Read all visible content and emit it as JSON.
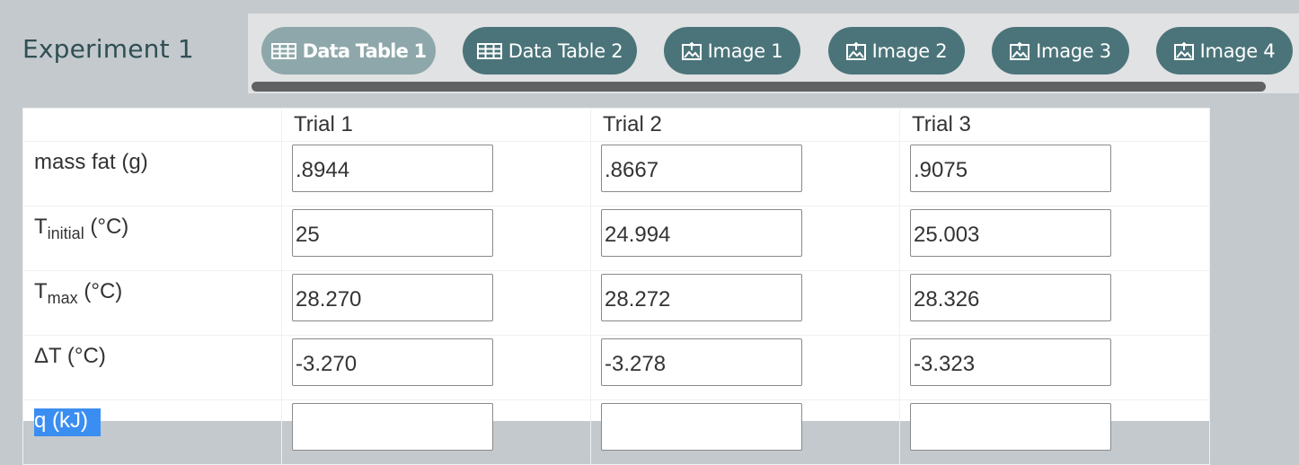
{
  "experiment": {
    "title": "Experiment 1"
  },
  "tabs": [
    {
      "label": "Data Table 1",
      "icon": "table-icon",
      "active": true
    },
    {
      "label": "Data Table 2",
      "icon": "table-icon",
      "active": false
    },
    {
      "label": "Image 1",
      "icon": "image-icon",
      "active": false
    },
    {
      "label": "Image 2",
      "icon": "image-icon",
      "active": false
    },
    {
      "label": "Image 3",
      "icon": "image-icon",
      "active": false
    },
    {
      "label": "Image 4",
      "icon": "image-icon",
      "active": false
    }
  ],
  "table": {
    "headers": [
      "",
      "Trial 1",
      "Trial 2",
      "Trial 3"
    ],
    "rows": [
      {
        "label": "mass fat (g)",
        "values": [
          ".8944",
          ".8667",
          ".9075"
        ]
      },
      {
        "label_main": "T",
        "label_sub": "initial",
        "label_unit": " (°C)",
        "values": [
          "25",
          "24.994",
          "25.003"
        ]
      },
      {
        "label_main": "T",
        "label_sub": "max",
        "label_unit": " (°C)",
        "values": [
          "28.270",
          "28.272",
          "28.326"
        ]
      },
      {
        "label": "ΔT (°C)",
        "values": [
          "-3.270",
          "-3.278",
          "-3.323"
        ]
      },
      {
        "label": "q (kJ)",
        "values": [
          "",
          "",
          ""
        ],
        "selected": true
      }
    ]
  },
  "colors": {
    "tab": "#4b747a",
    "tab_active": "#8ea7aa",
    "selection": "#3b8ef1",
    "background": "#c3c9cc"
  }
}
